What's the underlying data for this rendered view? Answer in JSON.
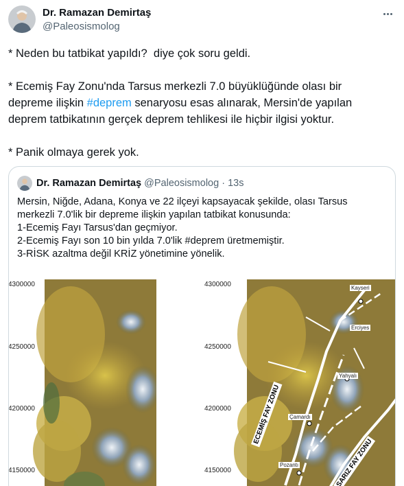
{
  "author": {
    "name": "Dr. Ramazan Demirtaş",
    "handle": "@Paleosismolog"
  },
  "tweet": {
    "line1": "* Neden bu tatbikat yapıldı?  diye çok soru geldi.",
    "line2a": "* Ecemiş Fay Zonu'nda Tarsus merkezli 7.0 büyüklüğünde olası bir",
    "line2b_pre": "depreme ilişkin ",
    "line2b_tag": "#deprem",
    "line2b_post": " senaryosu esas alınarak, Mersin'de yapılan",
    "line2c": "deprem tatbikatının gerçek deprem tehlikesi ile hiçbir ilgisi yoktur.",
    "line3": "* Panik olmaya gerek yok."
  },
  "quote": {
    "name": "Dr. Ramazan Demirtaş",
    "handle": "@Paleosismolog",
    "separator": " · ",
    "time": "13s",
    "lines": [
      "Mersin, Niğde, Adana, Konya ve 22 ilçeyi kapsayacak şekilde, olası Tarsus",
      "merkezli 7.0'lik bir depreme ilişkin yapılan tatbikat konusunda:",
      "1-Ecemiş Fayı Tarsus'dan geçmiyor.",
      "2-Ecemiş Fayı son 10 bin yılda 7.0'lik #deprem üretmemiştir.",
      "3-RİSK azaltma değil KRİZ yönetimine yönelik."
    ]
  },
  "map": {
    "y_ticks": [
      "4300000",
      "4250000",
      "4200000",
      "4150000"
    ],
    "places": [
      "Kayseri",
      "Erciyes",
      "Yahyalı",
      "Çamardı",
      "Pozantı"
    ],
    "zones": [
      "ECEMİŞ FAY ZONU",
      "SARIZ FAY ZONU"
    ]
  },
  "colors": {
    "accent": "#1d9bf0",
    "text": "#0f1419",
    "muted": "#536471",
    "border": "#cfd9de"
  }
}
